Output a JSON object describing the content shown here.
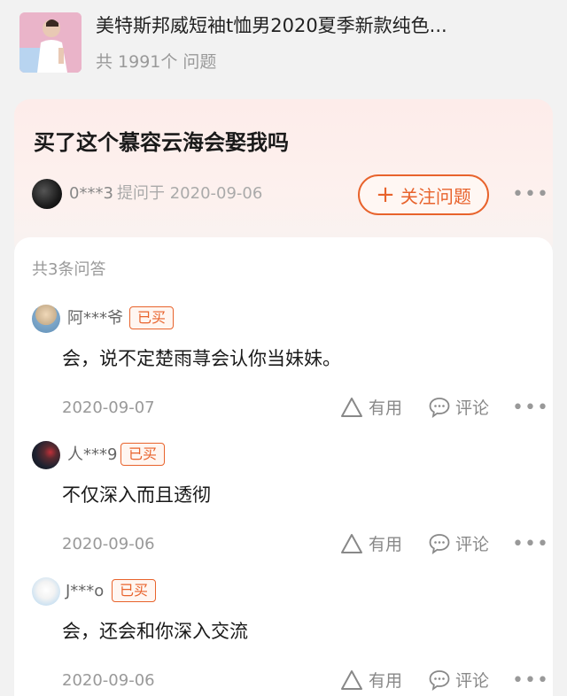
{
  "product": {
    "title": "美特斯邦威短袖t恤男2020夏季新款纯色...",
    "question_count": "共 1991个 问题"
  },
  "question": {
    "title": "买了这个慕容云海会娶我吗",
    "asker": "0***3",
    "asked_at": "提问于 2020-09-06",
    "follow_label": "关注问题",
    "more": "•••"
  },
  "answers_header": "共3条问答",
  "answers": [
    {
      "user": "阿***爷",
      "badge": "已买",
      "text": "会，说不定楚雨荨会认你当妹妹。",
      "date": "2020-09-07",
      "useful": "有用",
      "comment": "评论",
      "more": "•••"
    },
    {
      "user": "人***9",
      "badge": "已买",
      "text": "不仅深入而且透彻",
      "date": "2020-09-06",
      "useful": "有用",
      "comment": "评论",
      "more": "•••"
    },
    {
      "user": "J***o",
      "badge": "已买",
      "text": "会，还会和你深入交流",
      "date": "2020-09-06",
      "useful": "有用",
      "comment": "评论",
      "more": "•••"
    }
  ],
  "colors": {
    "accent": "#e8632c",
    "card_bg": "#fdecea",
    "page_bg": "#f2f2f2"
  },
  "icons": [
    "product-thumbnail",
    "useful-triangle-icon",
    "comment-bubble-icon",
    "more-dots-icon"
  ]
}
